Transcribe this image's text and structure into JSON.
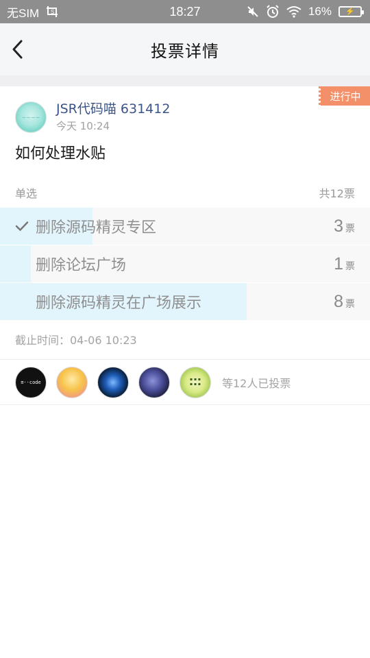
{
  "status_bar": {
    "carrier": "无SIM",
    "time": "18:27",
    "battery": "16%"
  },
  "header": {
    "title": "投票详情"
  },
  "post": {
    "status_tag": "进行中",
    "author": "JSR代码喵 631412",
    "time": "今天 10:24",
    "question": "如何处理水贴",
    "vote_type": "单选",
    "vote_total": "共12票",
    "deadline": "截止时间：04-06 10:23",
    "options": [
      {
        "label": "删除源码精灵专区",
        "count": "3",
        "unit": "票",
        "fraction": 0.25,
        "checked": true
      },
      {
        "label": "删除论坛广场",
        "count": "1",
        "unit": "票",
        "fraction": 0.083,
        "checked": false
      },
      {
        "label": "删除源码精灵在广场展示",
        "count": "8",
        "unit": "票",
        "fraction": 0.667,
        "checked": false
      }
    ]
  },
  "voters": {
    "summary": "等12人已投票"
  },
  "colors": {
    "status_tag": "#f3906a",
    "author_name": "#3b5487",
    "option_fill": "#e3f5fc"
  }
}
